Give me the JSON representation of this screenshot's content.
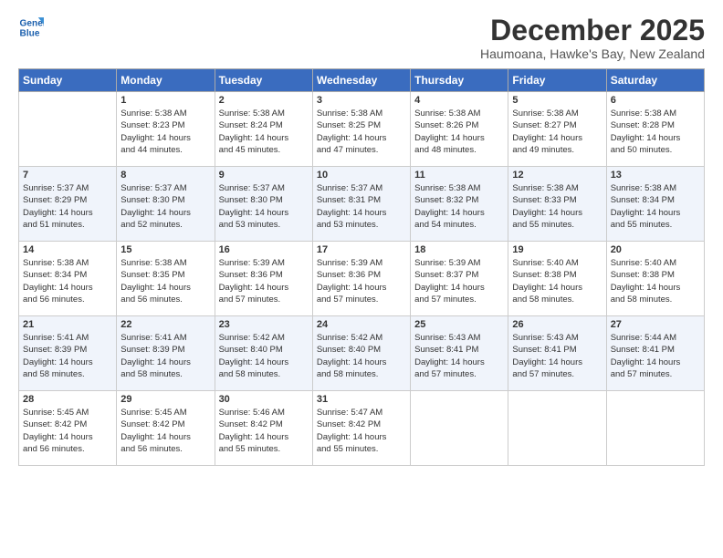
{
  "logo": {
    "line1": "General",
    "line2": "Blue"
  },
  "title": "December 2025",
  "location": "Haumoana, Hawke's Bay, New Zealand",
  "weekdays": [
    "Sunday",
    "Monday",
    "Tuesday",
    "Wednesday",
    "Thursday",
    "Friday",
    "Saturday"
  ],
  "weeks": [
    [
      {
        "day": "",
        "info": ""
      },
      {
        "day": "1",
        "info": "Sunrise: 5:38 AM\nSunset: 8:23 PM\nDaylight: 14 hours\nand 44 minutes."
      },
      {
        "day": "2",
        "info": "Sunrise: 5:38 AM\nSunset: 8:24 PM\nDaylight: 14 hours\nand 45 minutes."
      },
      {
        "day": "3",
        "info": "Sunrise: 5:38 AM\nSunset: 8:25 PM\nDaylight: 14 hours\nand 47 minutes."
      },
      {
        "day": "4",
        "info": "Sunrise: 5:38 AM\nSunset: 8:26 PM\nDaylight: 14 hours\nand 48 minutes."
      },
      {
        "day": "5",
        "info": "Sunrise: 5:38 AM\nSunset: 8:27 PM\nDaylight: 14 hours\nand 49 minutes."
      },
      {
        "day": "6",
        "info": "Sunrise: 5:38 AM\nSunset: 8:28 PM\nDaylight: 14 hours\nand 50 minutes."
      }
    ],
    [
      {
        "day": "7",
        "info": "Sunrise: 5:37 AM\nSunset: 8:29 PM\nDaylight: 14 hours\nand 51 minutes."
      },
      {
        "day": "8",
        "info": "Sunrise: 5:37 AM\nSunset: 8:30 PM\nDaylight: 14 hours\nand 52 minutes."
      },
      {
        "day": "9",
        "info": "Sunrise: 5:37 AM\nSunset: 8:30 PM\nDaylight: 14 hours\nand 53 minutes."
      },
      {
        "day": "10",
        "info": "Sunrise: 5:37 AM\nSunset: 8:31 PM\nDaylight: 14 hours\nand 53 minutes."
      },
      {
        "day": "11",
        "info": "Sunrise: 5:38 AM\nSunset: 8:32 PM\nDaylight: 14 hours\nand 54 minutes."
      },
      {
        "day": "12",
        "info": "Sunrise: 5:38 AM\nSunset: 8:33 PM\nDaylight: 14 hours\nand 55 minutes."
      },
      {
        "day": "13",
        "info": "Sunrise: 5:38 AM\nSunset: 8:34 PM\nDaylight: 14 hours\nand 55 minutes."
      }
    ],
    [
      {
        "day": "14",
        "info": "Sunrise: 5:38 AM\nSunset: 8:34 PM\nDaylight: 14 hours\nand 56 minutes."
      },
      {
        "day": "15",
        "info": "Sunrise: 5:38 AM\nSunset: 8:35 PM\nDaylight: 14 hours\nand 56 minutes."
      },
      {
        "day": "16",
        "info": "Sunrise: 5:39 AM\nSunset: 8:36 PM\nDaylight: 14 hours\nand 57 minutes."
      },
      {
        "day": "17",
        "info": "Sunrise: 5:39 AM\nSunset: 8:36 PM\nDaylight: 14 hours\nand 57 minutes."
      },
      {
        "day": "18",
        "info": "Sunrise: 5:39 AM\nSunset: 8:37 PM\nDaylight: 14 hours\nand 57 minutes."
      },
      {
        "day": "19",
        "info": "Sunrise: 5:40 AM\nSunset: 8:38 PM\nDaylight: 14 hours\nand 58 minutes."
      },
      {
        "day": "20",
        "info": "Sunrise: 5:40 AM\nSunset: 8:38 PM\nDaylight: 14 hours\nand 58 minutes."
      }
    ],
    [
      {
        "day": "21",
        "info": "Sunrise: 5:41 AM\nSunset: 8:39 PM\nDaylight: 14 hours\nand 58 minutes."
      },
      {
        "day": "22",
        "info": "Sunrise: 5:41 AM\nSunset: 8:39 PM\nDaylight: 14 hours\nand 58 minutes."
      },
      {
        "day": "23",
        "info": "Sunrise: 5:42 AM\nSunset: 8:40 PM\nDaylight: 14 hours\nand 58 minutes."
      },
      {
        "day": "24",
        "info": "Sunrise: 5:42 AM\nSunset: 8:40 PM\nDaylight: 14 hours\nand 58 minutes."
      },
      {
        "day": "25",
        "info": "Sunrise: 5:43 AM\nSunset: 8:41 PM\nDaylight: 14 hours\nand 57 minutes."
      },
      {
        "day": "26",
        "info": "Sunrise: 5:43 AM\nSunset: 8:41 PM\nDaylight: 14 hours\nand 57 minutes."
      },
      {
        "day": "27",
        "info": "Sunrise: 5:44 AM\nSunset: 8:41 PM\nDaylight: 14 hours\nand 57 minutes."
      }
    ],
    [
      {
        "day": "28",
        "info": "Sunrise: 5:45 AM\nSunset: 8:42 PM\nDaylight: 14 hours\nand 56 minutes."
      },
      {
        "day": "29",
        "info": "Sunrise: 5:45 AM\nSunset: 8:42 PM\nDaylight: 14 hours\nand 56 minutes."
      },
      {
        "day": "30",
        "info": "Sunrise: 5:46 AM\nSunset: 8:42 PM\nDaylight: 14 hours\nand 55 minutes."
      },
      {
        "day": "31",
        "info": "Sunrise: 5:47 AM\nSunset: 8:42 PM\nDaylight: 14 hours\nand 55 minutes."
      },
      {
        "day": "",
        "info": ""
      },
      {
        "day": "",
        "info": ""
      },
      {
        "day": "",
        "info": ""
      }
    ]
  ]
}
